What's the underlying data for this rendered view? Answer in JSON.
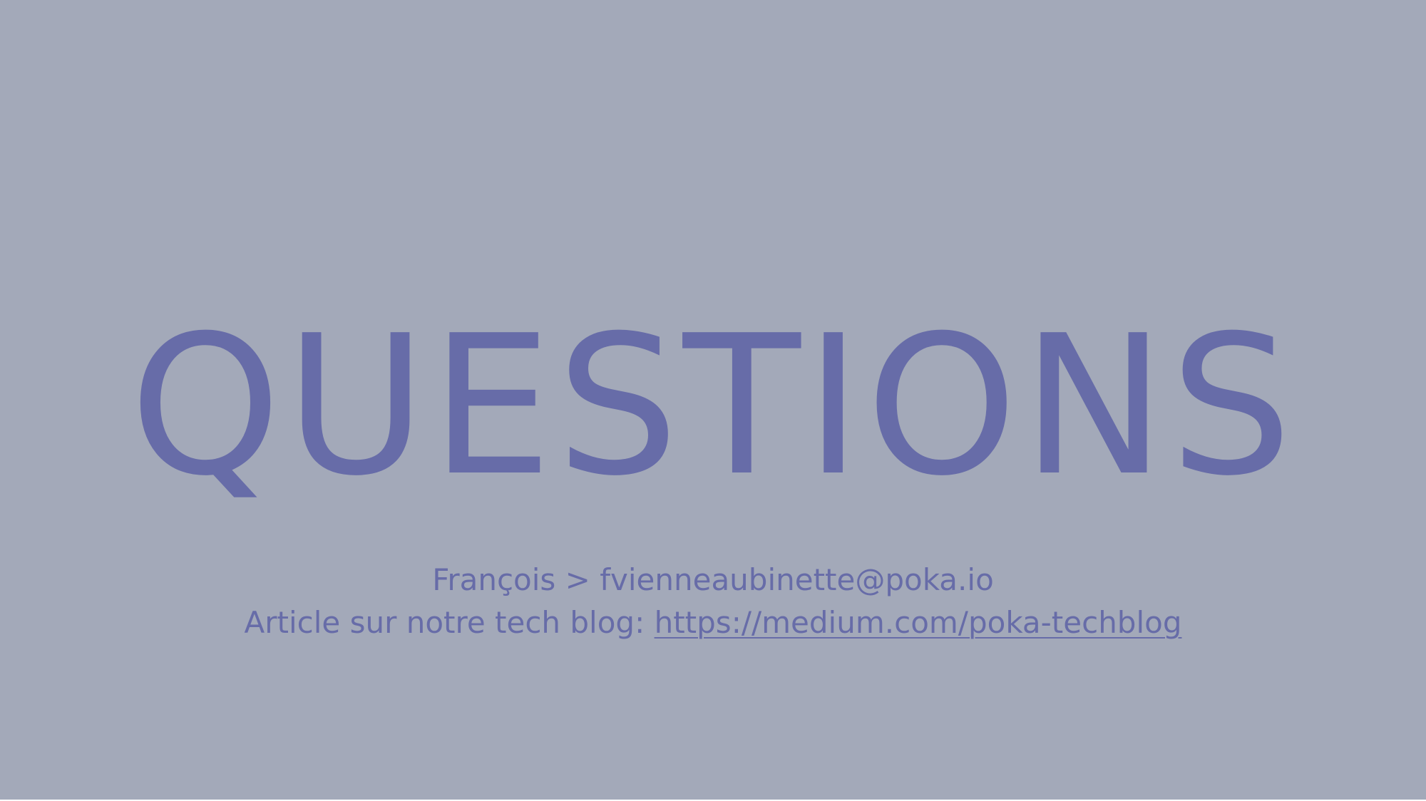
{
  "slide": {
    "title": "QUESTIONS",
    "contact": {
      "name": "François",
      "separator": " > ",
      "email": "fvienneaubinette@poka.io"
    },
    "article": {
      "prefix": "Article sur notre tech blog: ",
      "link_text": "https://medium.com/poka-techblog"
    }
  },
  "colors": {
    "background": "#a3a9b9",
    "text": "#676ca8"
  }
}
